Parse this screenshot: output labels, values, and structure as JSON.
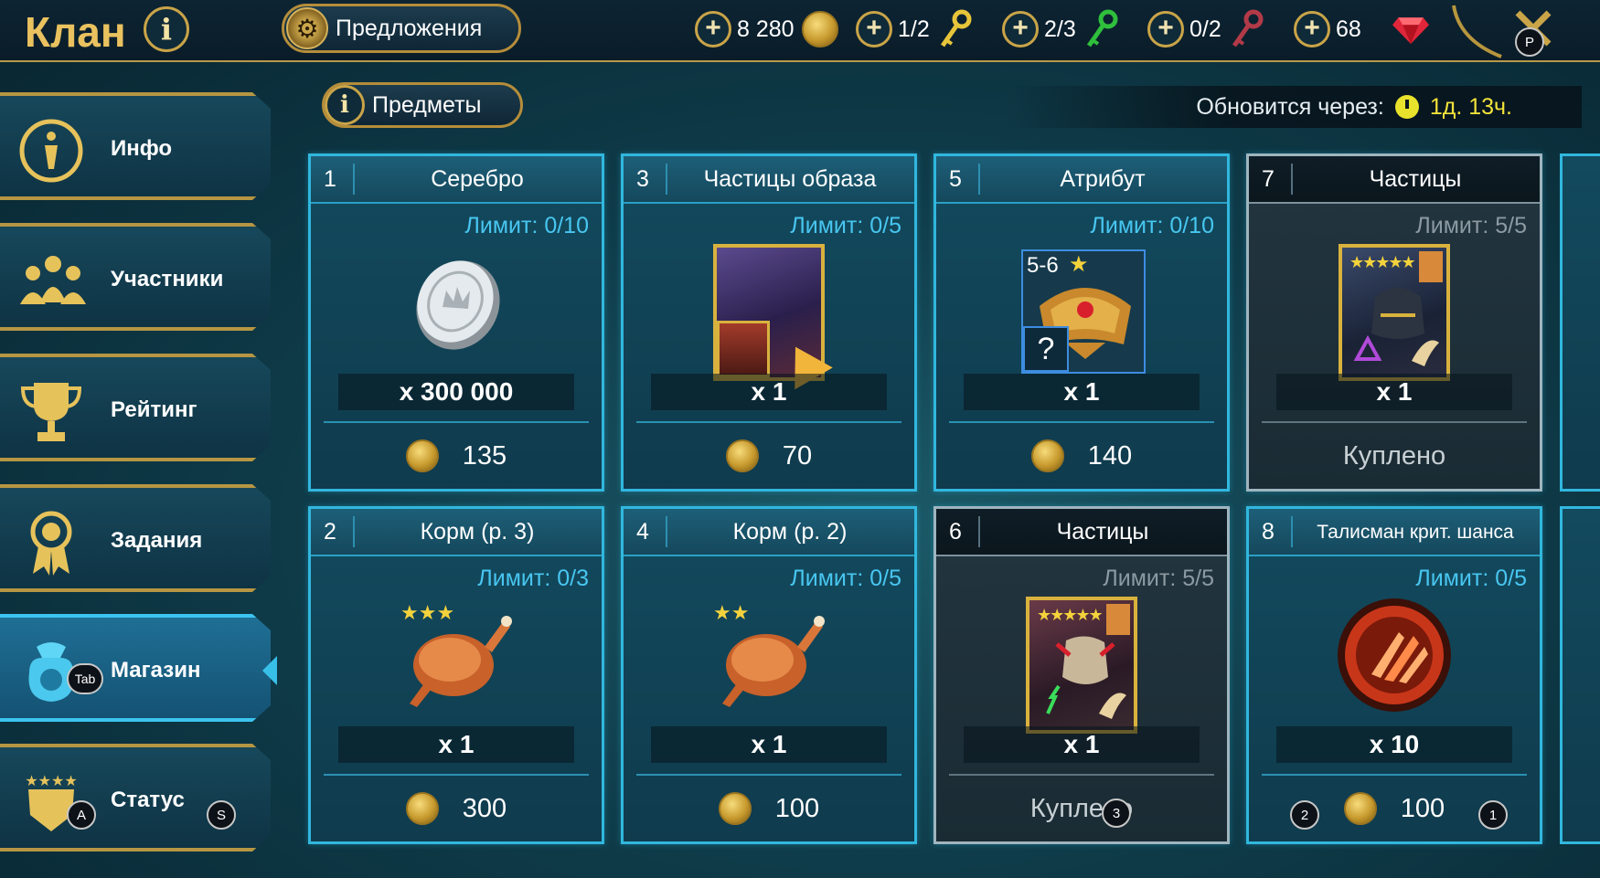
{
  "topbar": {
    "title": "Клан",
    "info_symbol": "i",
    "offers_label": "Предложения",
    "resources": [
      {
        "value": "8 280",
        "icon": "coin-icon"
      },
      {
        "value": "1/2",
        "icon": "gold-key-icon"
      },
      {
        "value": "2/3",
        "icon": "green-key-icon"
      },
      {
        "value": "0/2",
        "icon": "red-key-icon"
      },
      {
        "value": "68",
        "icon": "ruby-gem-icon"
      }
    ],
    "plus_symbol": "+",
    "close_key": "P"
  },
  "sidebar": {
    "items": [
      {
        "label": "Инфо",
        "icon": "info-icon"
      },
      {
        "label": "Участники",
        "icon": "members-icon"
      },
      {
        "label": "Рейтинг",
        "icon": "trophy-icon"
      },
      {
        "label": "Задания",
        "icon": "medal-icon"
      },
      {
        "label": "Магазин",
        "icon": "shop-bag-icon",
        "active": true,
        "key": "Tab"
      },
      {
        "label": "Статус",
        "icon": "shield-stars-icon",
        "keys": [
          "A",
          "S"
        ]
      }
    ]
  },
  "shop": {
    "items_label": "Предметы",
    "refresh_label": "Обновится через:",
    "refresh_time": "1д. 13ч.",
    "cards": [
      {
        "num": "1",
        "title": "Серебро",
        "limit": "Лимит: 0/10",
        "qty": "x 300 000",
        "price": "135",
        "bought": false,
        "icon": "silver-coin-icon"
      },
      {
        "num": "3",
        "title": "Частицы образа",
        "limit": "Лимит: 0/5",
        "qty": "x 1",
        "price": "70",
        "bought": false,
        "icon": "skin-shards-icon"
      },
      {
        "num": "5",
        "title": "Атрибут",
        "limit": "Лимит: 0/10",
        "qty": "x 1",
        "price": "140",
        "bought": false,
        "icon": "artifact-helmet-icon",
        "rank": "5-6",
        "unknown": "?"
      },
      {
        "num": "7",
        "title": "Частицы",
        "limit": "Лимит: 5/5",
        "qty": "x 1",
        "status": "Куплено",
        "bought": true,
        "icon": "champion-shards-icon"
      },
      {
        "num": "2",
        "title": "Корм (р. 3)",
        "limit": "Лимит: 0/3",
        "qty": "x 1",
        "price": "300",
        "bought": false,
        "icon": "chicken-3star-icon"
      },
      {
        "num": "4",
        "title": "Корм (р. 2)",
        "limit": "Лимит: 0/5",
        "qty": "x 1",
        "price": "100",
        "bought": false,
        "icon": "chicken-2star-icon"
      },
      {
        "num": "6",
        "title": "Частицы",
        "limit": "Лимит: 5/5",
        "qty": "x 1",
        "status": "Куплено",
        "bought": true,
        "icon": "champion-shards-icon"
      },
      {
        "num": "8",
        "title": "Талисман крит. шанса",
        "limit": "Лимит: 0/5",
        "qty": "x 10",
        "price": "100",
        "bought": false,
        "icon": "crit-talisman-icon"
      }
    ],
    "overlay_keys": [
      "3",
      "2",
      "1"
    ]
  },
  "colors": {
    "accent_gold": "#c9a448",
    "limit_blue": "#48c6f0",
    "card_border": "#31b7de",
    "refresh_yellow": "#f2e23a"
  }
}
